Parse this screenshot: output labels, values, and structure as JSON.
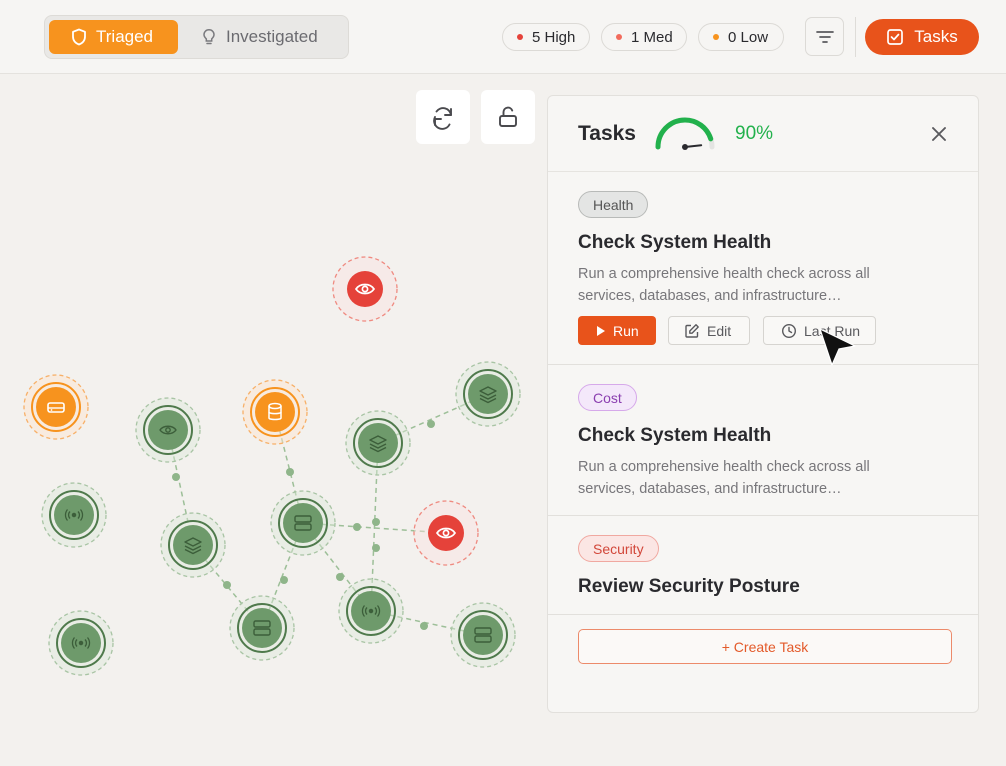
{
  "header": {
    "segments": [
      {
        "label": "Triaged",
        "icon": "shield-icon",
        "active": true
      },
      {
        "label": "Investigated",
        "icon": "lightbulb-icon",
        "active": false
      }
    ],
    "severity": [
      {
        "label": "5 High",
        "color": "#e5423a"
      },
      {
        "label": "1 Med",
        "color": "#f26b5c"
      },
      {
        "label": "0 Low",
        "color": "#f7931e"
      }
    ],
    "filter_icon": "filter-icon",
    "tasks_button": "Tasks"
  },
  "colors": {
    "accent_orange": "#f7931e",
    "accent_red": "#e8531b",
    "node_green": "#6e9a6b",
    "node_orange": "#f7931e",
    "node_red": "#e5423a",
    "gauge_green": "#22b14c"
  },
  "graph": {
    "toolbar": [
      {
        "name": "refresh",
        "icon": "refresh-icon"
      },
      {
        "name": "unlock",
        "icon": "unlock-icon"
      }
    ],
    "nodes": [
      {
        "id": "n1",
        "kind": "eye",
        "status": "critical"
      },
      {
        "id": "n2",
        "kind": "drive",
        "status": "warning"
      },
      {
        "id": "n3",
        "kind": "eye",
        "status": "normal"
      },
      {
        "id": "n4",
        "kind": "database",
        "status": "warning"
      },
      {
        "id": "n5",
        "kind": "layers",
        "status": "normal"
      },
      {
        "id": "n6",
        "kind": "layers",
        "status": "normal"
      },
      {
        "id": "n7",
        "kind": "wireless",
        "status": "normal"
      },
      {
        "id": "n8",
        "kind": "layers",
        "status": "normal"
      },
      {
        "id": "n9",
        "kind": "server",
        "status": "normal"
      },
      {
        "id": "n10",
        "kind": "eye",
        "status": "critical"
      },
      {
        "id": "n11",
        "kind": "wireless",
        "status": "normal"
      },
      {
        "id": "n12",
        "kind": "server",
        "status": "normal"
      },
      {
        "id": "n13",
        "kind": "wireless",
        "status": "normal"
      },
      {
        "id": "n14",
        "kind": "server",
        "status": "normal"
      }
    ],
    "edges": [
      [
        "n3",
        "n8"
      ],
      [
        "n8",
        "n12"
      ],
      [
        "n4",
        "n9"
      ],
      [
        "n9",
        "n12"
      ],
      [
        "n9",
        "n13"
      ],
      [
        "n5",
        "n6"
      ],
      [
        "n5",
        "n13"
      ],
      [
        "n9",
        "n10"
      ],
      [
        "n13",
        "n14"
      ]
    ]
  },
  "panel": {
    "title": "Tasks",
    "progress_percent": 90,
    "progress_label": "90%",
    "close_icon": "close-icon",
    "tasks": [
      {
        "tag": "Health",
        "title": "Check System Health",
        "description": "Run a comprehensive health check across all services, databases, and infrastructure…",
        "actions": {
          "run": "Run",
          "edit": "Edit",
          "last_run": "Last Run"
        }
      },
      {
        "tag": "Cost",
        "title": "Check System Health",
        "description": "Run a comprehensive health check across all services, databases, and infrastructure…"
      },
      {
        "tag": "Security",
        "title": "Review Security Posture"
      }
    ],
    "create_button": "+ Create Task"
  }
}
